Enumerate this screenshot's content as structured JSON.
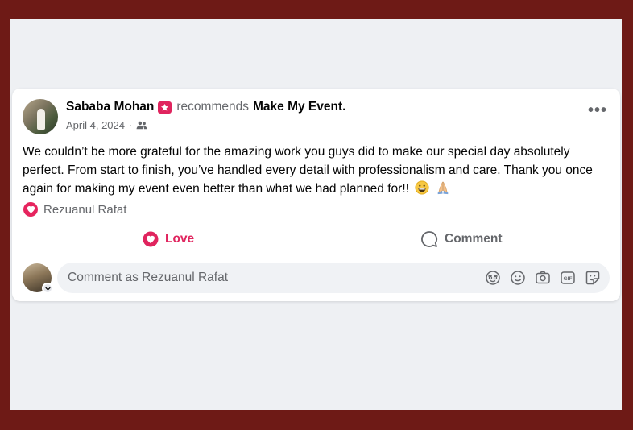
{
  "post": {
    "author_name": "Sababa Mohan",
    "recommends_text": "recommends",
    "page_name": "Make My Event.",
    "date": "April 4, 2024",
    "separator": "·",
    "audience_icon": "friends-icon",
    "more_label": "•••",
    "body": "We couldn’t be more grateful for the amazing work you guys did to make our special day absolutely perfect. From start to finish, you’ve handled every detail with professionalism and care. Thank you once again for making my event even better than what we had planned for!!",
    "emojis": [
      "grinning-face",
      "folded-hands"
    ]
  },
  "reactions": {
    "icon": "love-reaction-icon",
    "reactor_name": "Rezuanul Rafat"
  },
  "actions": {
    "love_label": "Love",
    "comment_label": "Comment"
  },
  "comment_composer": {
    "placeholder": "Comment as Rezuanul Rafat",
    "tools": [
      "avatar-sticker-icon",
      "emoji-icon",
      "camera-icon",
      "gif-icon",
      "sticker-icon"
    ]
  },
  "colors": {
    "love_red": "#e0245e",
    "secondary_text": "#65676b",
    "page_background": "#6e1a16"
  }
}
